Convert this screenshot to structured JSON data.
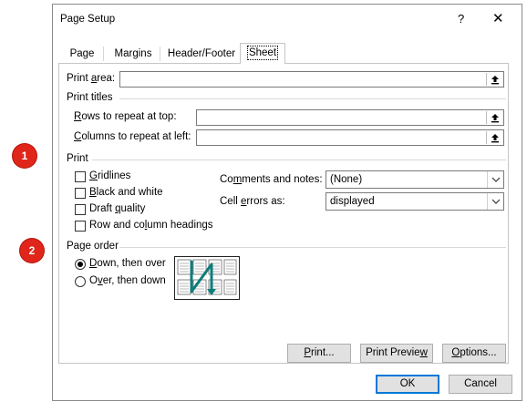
{
  "dialog": {
    "title": "Page Setup",
    "help": "?",
    "close": "✕"
  },
  "tabs": [
    {
      "label": "Page"
    },
    {
      "label": "Margins"
    },
    {
      "label": "Header/Footer"
    },
    {
      "label": "Sheet"
    }
  ],
  "print_area": {
    "label_pre": "Print ",
    "label_u": "a",
    "label_post": "rea:",
    "value": ""
  },
  "print_titles": {
    "heading": "Print titles",
    "rows": {
      "label_u": "R",
      "label_post": "ows to repeat at top:",
      "value": ""
    },
    "cols": {
      "label_u": "C",
      "label_post": "olumns to repeat at left:",
      "value": ""
    }
  },
  "print": {
    "heading": "Print",
    "gridlines": {
      "label_u": "G",
      "label_post": "ridlines",
      "checked": false
    },
    "black_white": {
      "label_u": "B",
      "label_post": "lack and white",
      "checked": false
    },
    "draft": {
      "label_pre": "Draft ",
      "label_u": "q",
      "label_post": "uality",
      "checked": false
    },
    "headings": {
      "label_pre": "Row and co",
      "label_u": "l",
      "label_post": "umn headings",
      "checked": false
    },
    "comments": {
      "label_pre": "Co",
      "label_u": "m",
      "label_post": "ments and notes:",
      "value": "(None)"
    },
    "cell_errors": {
      "label_pre": "Cell ",
      "label_u": "e",
      "label_post": "rrors as:",
      "value": "displayed"
    }
  },
  "page_order": {
    "heading": "Page order",
    "down_over": {
      "label_u": "D",
      "label_post": "own, then over",
      "selected": true
    },
    "over_down": {
      "label_pre": "O",
      "label_u": "v",
      "label_post": "er, then down",
      "selected": false
    }
  },
  "buttons": {
    "print": {
      "label_u": "P",
      "label_post": "rint..."
    },
    "preview": {
      "label_pre": "Print Previe",
      "label_u": "w",
      "label_post": ""
    },
    "options": {
      "label_u": "O",
      "label_post": "ptions..."
    },
    "ok": "OK",
    "cancel": "Cancel"
  },
  "markers": [
    "1",
    "2"
  ],
  "colors": {
    "marker": "#e0261b",
    "accent": "#0078d7",
    "order_arrow": "#0e7c7b"
  }
}
